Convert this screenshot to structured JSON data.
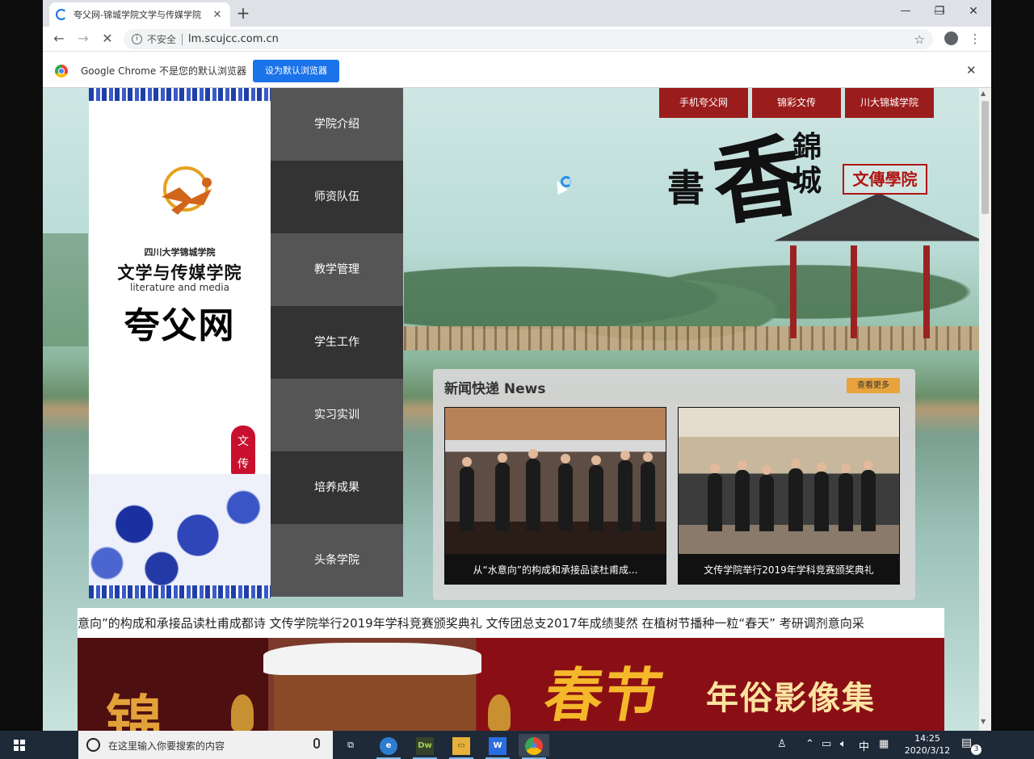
{
  "browser": {
    "tab_title": "夸父网-锦城学院文学与传媒学院",
    "tab_close": "✕",
    "new_tab": "+",
    "window_controls": [
      "—",
      "❐",
      "✕"
    ],
    "insecure_label": "不安全",
    "url": "lm.scujcc.com.cn",
    "infobar_text": "Google Chrome 不是您的默认浏览器",
    "infobar_button": "设为默认浏览器",
    "infobar_close": "✕"
  },
  "site": {
    "school_name": "四川大学锦城学院",
    "college_name": "文学与传媒学院",
    "college_en": "literature and media",
    "site_name": "夸父网",
    "seal_text": "文 传",
    "nav_items": [
      "学院介绍",
      "师资队伍",
      "教学管理",
      "学生工作",
      "实习实训",
      "培养成果",
      "头条学院"
    ],
    "top_links": [
      "手机夸父网",
      "锦彩文传",
      "川大锦城学院"
    ],
    "calligraphy": {
      "shu": "書",
      "xiang": "香",
      "jincheng": "錦城",
      "college_stamp": "文傳學院"
    },
    "news": {
      "title": "新闻快递 News",
      "more": "查看更多",
      "items": [
        {
          "caption": "从“水意向”的构成和承接品读杜甫成..."
        },
        {
          "caption": "文传学院举行2019年学科竞赛颁奖典礼"
        }
      ]
    },
    "marquee": "意向”的构成和承接品读杜甫成都诗 文传学院举行2019年学科竞赛颁奖典礼 文传团总支2017年成绩斐然 在植树节播种一粒“春天” 考研调剂意向采",
    "banner": {
      "left_char": "锦",
      "chun": "春节",
      "title": "年俗影像集"
    }
  },
  "taskbar": {
    "search_placeholder": "在这里输入你要搜索的内容",
    "apps": [
      {
        "icon": "task-view-icon",
        "label": "⧉"
      },
      {
        "icon": "edge-icon",
        "label": "e"
      },
      {
        "icon": "dreamweaver-icon",
        "label": "Dw"
      },
      {
        "icon": "file-explorer-icon",
        "label": "▭"
      },
      {
        "icon": "wps-icon",
        "label": "W"
      },
      {
        "icon": "chrome-icon",
        "label": "◉"
      }
    ],
    "ime": "中",
    "time": "14:25",
    "date": "2020/3/12",
    "notification_count": "3"
  },
  "colors": {
    "nav_light": "#555555",
    "nav_dark": "#333333",
    "top_link": "#9b1c1c",
    "news_more": "#e8a33c",
    "chrome_blue": "#1a73e8"
  }
}
